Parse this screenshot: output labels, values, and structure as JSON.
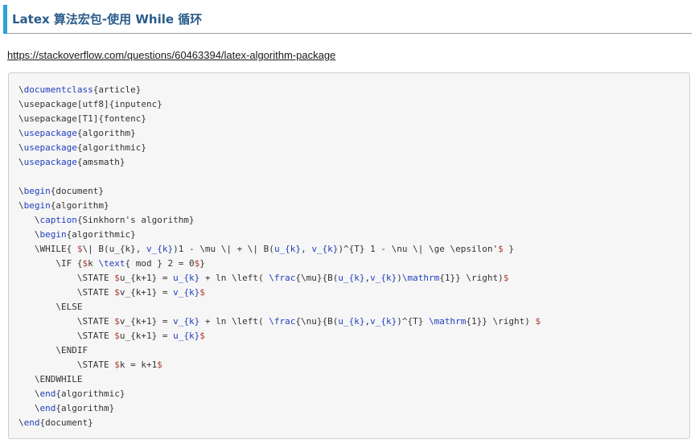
{
  "header": {
    "title": "Latex 算法宏包-使用 While 循环"
  },
  "source": {
    "url": "https://stackoverflow.com/questions/60463394/latex-algorithm-package"
  },
  "colors": {
    "accent": "#2ba3d8",
    "title": "#2b5c8a",
    "keyword": "#1f3fbf",
    "math": "#b03a2e"
  },
  "code": {
    "lines": [
      [
        {
          "t": "\\"
        },
        {
          "t": "documentclass",
          "c": "kw"
        },
        {
          "t": "{article}"
        }
      ],
      [
        {
          "t": "\\usepackage[utf8]{inputenc}"
        }
      ],
      [
        {
          "t": "\\usepackage[T1]{fontenc}"
        }
      ],
      [
        {
          "t": "\\"
        },
        {
          "t": "usepackage",
          "c": "kw"
        },
        {
          "t": "{algorithm}"
        }
      ],
      [
        {
          "t": "\\"
        },
        {
          "t": "usepackage",
          "c": "kw"
        },
        {
          "t": "{algorithmic}"
        }
      ],
      [
        {
          "t": "\\"
        },
        {
          "t": "usepackage",
          "c": "kw"
        },
        {
          "t": "{amsmath}"
        }
      ],
      [
        {
          "t": ""
        }
      ],
      [
        {
          "t": "\\"
        },
        {
          "t": "begin",
          "c": "kw"
        },
        {
          "t": "{document}"
        }
      ],
      [
        {
          "t": "\\"
        },
        {
          "t": "begin",
          "c": "kw"
        },
        {
          "t": "{algorithm}"
        }
      ],
      [
        {
          "t": "   \\"
        },
        {
          "t": "caption",
          "c": "kw"
        },
        {
          "t": "{Sinkhorn's algorithm}"
        }
      ],
      [
        {
          "t": "   \\"
        },
        {
          "t": "begin",
          "c": "kw"
        },
        {
          "t": "{algorithmic}"
        }
      ],
      [
        {
          "t": "   \\WHILE{ "
        },
        {
          "t": "$",
          "c": "math"
        },
        {
          "t": "\\| B(u_{k}, "
        },
        {
          "t": "v_{k}",
          "c": "kw"
        },
        {
          "t": ")1 - \\mu \\| + \\| B("
        },
        {
          "t": "u_{k}",
          "c": "kw"
        },
        {
          "t": ", "
        },
        {
          "t": "v_{k}",
          "c": "kw"
        },
        {
          "t": ")^{T} 1 - \\nu \\| \\ge \\epsilon'"
        },
        {
          "t": "$",
          "c": "math"
        },
        {
          "t": " }"
        }
      ],
      [
        {
          "t": "       \\IF {"
        },
        {
          "t": "$",
          "c": "math"
        },
        {
          "t": "k "
        },
        {
          "t": "\\text",
          "c": "kw"
        },
        {
          "t": "{ mod } 2 = 0"
        },
        {
          "t": "$",
          "c": "math"
        },
        {
          "t": "}"
        }
      ],
      [
        {
          "t": "           \\STATE "
        },
        {
          "t": "$",
          "c": "math"
        },
        {
          "t": "u_{k+1} = "
        },
        {
          "t": "u_{k}",
          "c": "kw"
        },
        {
          "t": " + ln \\left( "
        },
        {
          "t": "\\frac",
          "c": "kw"
        },
        {
          "t": "{\\mu}{B("
        },
        {
          "t": "u_{k}",
          "c": "kw"
        },
        {
          "t": ","
        },
        {
          "t": "v_{k}",
          "c": "kw"
        },
        {
          "t": ")"
        },
        {
          "t": "\\mathrm",
          "c": "kw"
        },
        {
          "t": "{1}} \\right)"
        },
        {
          "t": "$",
          "c": "math"
        }
      ],
      [
        {
          "t": "           \\STATE "
        },
        {
          "t": "$",
          "c": "math"
        },
        {
          "t": "v_{k+1} = "
        },
        {
          "t": "v_{k}",
          "c": "kw"
        },
        {
          "t": "$",
          "c": "math"
        }
      ],
      [
        {
          "t": "       \\ELSE"
        }
      ],
      [
        {
          "t": "           \\STATE "
        },
        {
          "t": "$",
          "c": "math"
        },
        {
          "t": "v_{k+1} = "
        },
        {
          "t": "v_{k}",
          "c": "kw"
        },
        {
          "t": " + ln \\left( "
        },
        {
          "t": "\\frac",
          "c": "kw"
        },
        {
          "t": "{\\nu}{B("
        },
        {
          "t": "u_{k}",
          "c": "kw"
        },
        {
          "t": ","
        },
        {
          "t": "v_{k}",
          "c": "kw"
        },
        {
          "t": ")^{T} "
        },
        {
          "t": "\\mathrm",
          "c": "kw"
        },
        {
          "t": "{1}} \\right) "
        },
        {
          "t": "$",
          "c": "math"
        }
      ],
      [
        {
          "t": "           \\STATE "
        },
        {
          "t": "$",
          "c": "math"
        },
        {
          "t": "u_{k+1} = "
        },
        {
          "t": "u_{k}",
          "c": "kw"
        },
        {
          "t": "$",
          "c": "math"
        }
      ],
      [
        {
          "t": "       \\ENDIF"
        }
      ],
      [
        {
          "t": "           \\STATE "
        },
        {
          "t": "$",
          "c": "math"
        },
        {
          "t": "k = k+1"
        },
        {
          "t": "$",
          "c": "math"
        }
      ],
      [
        {
          "t": "   \\ENDWHILE"
        }
      ],
      [
        {
          "t": "   \\"
        },
        {
          "t": "end",
          "c": "kw"
        },
        {
          "t": "{algorithmic}"
        }
      ],
      [
        {
          "t": "   \\"
        },
        {
          "t": "end",
          "c": "kw"
        },
        {
          "t": "{algorithm}"
        }
      ],
      [
        {
          "t": "\\"
        },
        {
          "t": "end",
          "c": "kw"
        },
        {
          "t": "{document}"
        }
      ]
    ]
  }
}
